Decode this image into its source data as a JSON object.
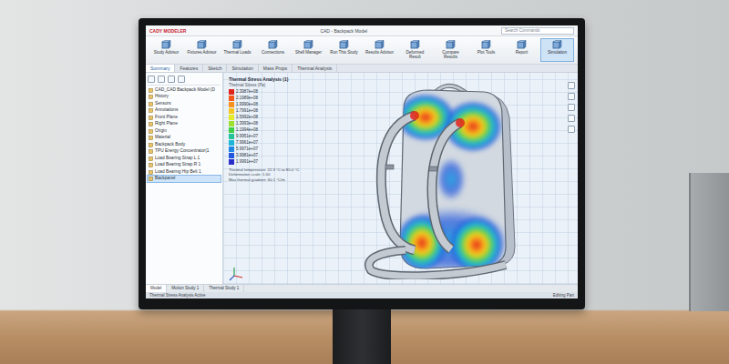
{
  "window": {
    "logo": "CADY MODELER",
    "title": "CAD - Backpack Model",
    "search": {
      "placeholder": "Search Commands"
    }
  },
  "ribbon": [
    {
      "label": "Study Advisor",
      "selected": false
    },
    {
      "label": "Fixtures Advisor",
      "selected": false
    },
    {
      "label": "Thermal Loads",
      "selected": false
    },
    {
      "label": "Connections",
      "selected": false
    },
    {
      "label": "Shell Manager",
      "selected": false
    },
    {
      "label": "Run This Study",
      "selected": false
    },
    {
      "label": "Results Advisor",
      "selected": false
    },
    {
      "label": "Deformed Result",
      "selected": false
    },
    {
      "label": "Compare Results",
      "selected": false
    },
    {
      "label": "Plot Tools",
      "selected": false
    },
    {
      "label": "Report",
      "selected": false
    },
    {
      "label": "Simulation",
      "selected": true
    }
  ],
  "command_tabs": [
    {
      "label": "Summary",
      "selected": true
    },
    {
      "label": "Features",
      "selected": false
    },
    {
      "label": "Sketch",
      "selected": false
    },
    {
      "label": "Simulation",
      "selected": false
    },
    {
      "label": "Mass Props",
      "selected": false
    },
    {
      "label": "Thermal Analysis",
      "selected": false
    }
  ],
  "tree": {
    "items": [
      {
        "label": "CAD_CAD Backpack Model (D",
        "selected": false
      },
      {
        "label": "History",
        "selected": false
      },
      {
        "label": "Sensors",
        "selected": false
      },
      {
        "label": "Annotations",
        "selected": false
      },
      {
        "label": "Front Plane",
        "selected": false
      },
      {
        "label": "Right Plane",
        "selected": false
      },
      {
        "label": "Origin",
        "selected": false
      },
      {
        "label": "Material",
        "selected": false
      },
      {
        "label": "Backpack Body",
        "selected": false
      },
      {
        "label": "TPU Energy Concentrator(1",
        "selected": false
      },
      {
        "label": "Load Bearing Strap L 1",
        "selected": false
      },
      {
        "label": "Load Bearing Strap R 1",
        "selected": false
      },
      {
        "label": "Load Bearing Hip Belt 1",
        "selected": false
      },
      {
        "label": "Backpanel",
        "selected": true
      }
    ]
  },
  "legend": {
    "title": "Thermal Stress Analysis (1)",
    "subtitle": "Thermal Stress (Pa)",
    "entries": [
      {
        "value": "2.3987e+08",
        "color": "#e0241b"
      },
      {
        "value": "2.1989e+08",
        "color": "#f2561a"
      },
      {
        "value": "1.9990e+08",
        "color": "#f8921c"
      },
      {
        "value": "1.7991e+08",
        "color": "#f6c81f"
      },
      {
        "value": "1.5992e+08",
        "color": "#e4ec27"
      },
      {
        "value": "1.3993e+08",
        "color": "#9ee02f"
      },
      {
        "value": "1.1994e+08",
        "color": "#3fcf45"
      },
      {
        "value": "9.9951e+07",
        "color": "#22c39a"
      },
      {
        "value": "7.9961e+07",
        "color": "#1fb4d8"
      },
      {
        "value": "5.9971e+07",
        "color": "#1f86e6"
      },
      {
        "value": "3.9981e+07",
        "color": "#2357dd"
      },
      {
        "value": "1.9991e+07",
        "color": "#2a2fc9"
      }
    ],
    "notes": [
      "Thermal temperature: 22.3 °C to 85.0 °C",
      "Deformation scale: 1.00",
      "Max thermal gradient: 60.1 °C/m"
    ]
  },
  "model_tabs": [
    {
      "label": "Model",
      "selected": true
    },
    {
      "label": "Motion Study 1",
      "selected": false
    },
    {
      "label": "Thermal Study 1",
      "selected": false
    }
  ],
  "status_bar": {
    "left": "Thermal Stress Analysis Active",
    "right": "Editing Part"
  }
}
